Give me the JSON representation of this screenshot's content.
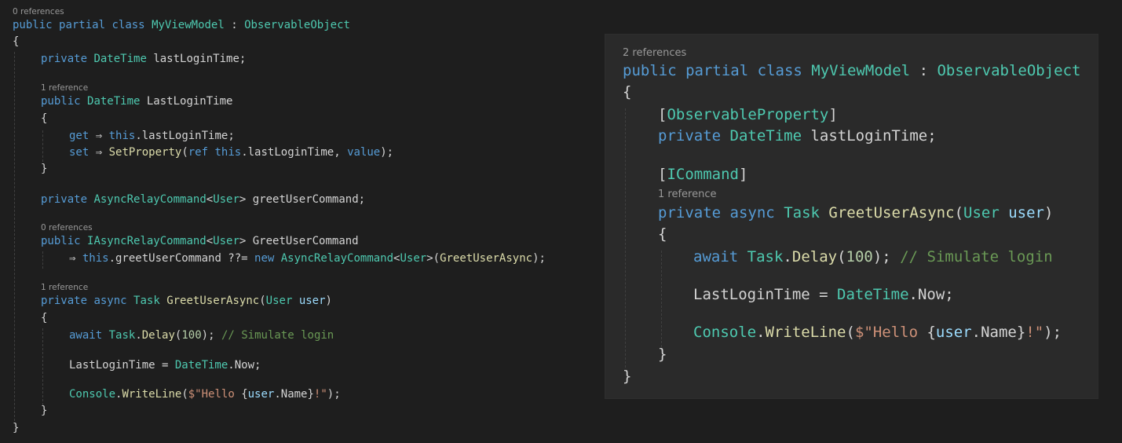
{
  "left": {
    "lens_0": "0 references",
    "lens_1": "1 reference",
    "lens_2": "0 references",
    "lens_3": "1 reference",
    "lines": [
      [
        [
          "kw",
          "public"
        ],
        [
          "pl",
          " "
        ],
        [
          "kw",
          "partial"
        ],
        [
          "pl",
          " "
        ],
        [
          "kw",
          "class"
        ],
        [
          "pl",
          " "
        ],
        [
          "ty",
          "MyViewModel"
        ],
        [
          "pl",
          " : "
        ],
        [
          "ty",
          "ObservableObject"
        ]
      ],
      [
        [
          "pl",
          "{"
        ]
      ],
      [
        [
          "kw",
          "private"
        ],
        [
          "pl",
          " "
        ],
        [
          "ty",
          "DateTime"
        ],
        [
          "pl",
          " lastLoginTime;"
        ]
      ],
      [
        [
          "kw",
          "public"
        ],
        [
          "pl",
          " "
        ],
        [
          "ty",
          "DateTime"
        ],
        [
          "pl",
          " LastLoginTime"
        ]
      ],
      [
        [
          "pl",
          "{"
        ]
      ],
      [
        [
          "kw",
          "get"
        ],
        [
          "pl",
          " ⇒ "
        ],
        [
          "kw",
          "this"
        ],
        [
          "pl",
          ".lastLoginTime;"
        ]
      ],
      [
        [
          "kw",
          "set"
        ],
        [
          "pl",
          " ⇒ "
        ],
        [
          "fn",
          "SetProperty"
        ],
        [
          "pl",
          "("
        ],
        [
          "kw",
          "ref"
        ],
        [
          "pl",
          " "
        ],
        [
          "kw",
          "this"
        ],
        [
          "pl",
          ".lastLoginTime, "
        ],
        [
          "kw",
          "value"
        ],
        [
          "pl",
          ");"
        ]
      ],
      [
        [
          "pl",
          "}"
        ]
      ],
      [
        [
          "kw",
          "private"
        ],
        [
          "pl",
          " "
        ],
        [
          "ty",
          "AsyncRelayCommand"
        ],
        [
          "pl",
          "<"
        ],
        [
          "ty",
          "User"
        ],
        [
          "pl",
          "> greetUserCommand;"
        ]
      ],
      [
        [
          "kw",
          "public"
        ],
        [
          "pl",
          " "
        ],
        [
          "ty",
          "IAsyncRelayCommand"
        ],
        [
          "pl",
          "<"
        ],
        [
          "ty",
          "User"
        ],
        [
          "pl",
          "> GreetUserCommand"
        ]
      ],
      [
        [
          "pl",
          "⇒ "
        ],
        [
          "kw",
          "this"
        ],
        [
          "pl",
          ".greetUserCommand ??= "
        ],
        [
          "kw",
          "new"
        ],
        [
          "pl",
          " "
        ],
        [
          "ty",
          "AsyncRelayCommand"
        ],
        [
          "pl",
          "<"
        ],
        [
          "ty",
          "User"
        ],
        [
          "pl",
          ">("
        ],
        [
          "fn",
          "GreetUserAsync"
        ],
        [
          "pl",
          ");"
        ]
      ],
      [
        [
          "kw",
          "private"
        ],
        [
          "pl",
          " "
        ],
        [
          "kw",
          "async"
        ],
        [
          "pl",
          " "
        ],
        [
          "ty",
          "Task"
        ],
        [
          "pl",
          " "
        ],
        [
          "fn",
          "GreetUserAsync"
        ],
        [
          "pl",
          "("
        ],
        [
          "ty",
          "User"
        ],
        [
          "pl",
          " "
        ],
        [
          "var",
          "user"
        ],
        [
          "pl",
          ")"
        ]
      ],
      [
        [
          "pl",
          "{"
        ]
      ],
      [
        [
          "kw",
          "await"
        ],
        [
          "pl",
          " "
        ],
        [
          "ty",
          "Task"
        ],
        [
          "pl",
          "."
        ],
        [
          "fn",
          "Delay"
        ],
        [
          "pl",
          "("
        ],
        [
          "num",
          "100"
        ],
        [
          "pl",
          "); "
        ],
        [
          "cmt",
          "// Simulate login"
        ]
      ],
      [
        [
          "pl",
          "LastLoginTime = "
        ],
        [
          "ty",
          "DateTime"
        ],
        [
          "pl",
          ".Now;"
        ]
      ],
      [
        [
          "ty",
          "Console"
        ],
        [
          "pl",
          "."
        ],
        [
          "fn",
          "WriteLine"
        ],
        [
          "pl",
          "("
        ],
        [
          "str",
          "$\"Hello "
        ],
        [
          "pl",
          "{"
        ],
        [
          "var",
          "user"
        ],
        [
          "pl",
          ".Name}"
        ],
        [
          "str",
          "!\""
        ],
        [
          "pl",
          ");"
        ]
      ],
      [
        [
          "pl",
          "}"
        ]
      ],
      [
        [
          "pl",
          "}"
        ]
      ]
    ]
  },
  "right": {
    "lens_0": "2 references",
    "lens_1": "1 reference",
    "lines": [
      [
        [
          "kw",
          "public"
        ],
        [
          "pl",
          " "
        ],
        [
          "kw",
          "partial"
        ],
        [
          "pl",
          " "
        ],
        [
          "kw",
          "class"
        ],
        [
          "pl",
          " "
        ],
        [
          "ty",
          "MyViewModel"
        ],
        [
          "pl",
          " : "
        ],
        [
          "ty",
          "ObservableObject"
        ]
      ],
      [
        [
          "pl",
          "{"
        ]
      ],
      [
        [
          "pl",
          "["
        ],
        [
          "ty",
          "ObservableProperty"
        ],
        [
          "pl",
          "]"
        ]
      ],
      [
        [
          "kw",
          "private"
        ],
        [
          "pl",
          " "
        ],
        [
          "ty",
          "DateTime"
        ],
        [
          "pl",
          " lastLoginTime;"
        ]
      ],
      [
        [
          "pl",
          "["
        ],
        [
          "ty",
          "ICommand"
        ],
        [
          "pl",
          "]"
        ]
      ],
      [
        [
          "kw",
          "private"
        ],
        [
          "pl",
          " "
        ],
        [
          "kw",
          "async"
        ],
        [
          "pl",
          " "
        ],
        [
          "ty",
          "Task"
        ],
        [
          "pl",
          " "
        ],
        [
          "fn",
          "GreetUserAsync"
        ],
        [
          "pl",
          "("
        ],
        [
          "ty",
          "User"
        ],
        [
          "pl",
          " "
        ],
        [
          "var",
          "user"
        ],
        [
          "pl",
          ")"
        ]
      ],
      [
        [
          "pl",
          "{"
        ]
      ],
      [
        [
          "kw",
          "await"
        ],
        [
          "pl",
          " "
        ],
        [
          "ty",
          "Task"
        ],
        [
          "pl",
          "."
        ],
        [
          "fn",
          "Delay"
        ],
        [
          "pl",
          "("
        ],
        [
          "num",
          "100"
        ],
        [
          "pl",
          "); "
        ],
        [
          "cmt",
          "// Simulate login"
        ]
      ],
      [
        [
          "pl",
          "LastLoginTime = "
        ],
        [
          "ty",
          "DateTime"
        ],
        [
          "pl",
          ".Now;"
        ]
      ],
      [
        [
          "ty",
          "Console"
        ],
        [
          "pl",
          "."
        ],
        [
          "fn",
          "WriteLine"
        ],
        [
          "pl",
          "("
        ],
        [
          "str",
          "$\"Hello "
        ],
        [
          "pl",
          "{"
        ],
        [
          "var",
          "user"
        ],
        [
          "pl",
          ".Name}"
        ],
        [
          "str",
          "!\""
        ],
        [
          "pl",
          ");"
        ]
      ],
      [
        [
          "pl",
          "}"
        ]
      ],
      [
        [
          "pl",
          "}"
        ]
      ]
    ]
  },
  "syntax_colors": {
    "kw": "#569cd6",
    "ty": "#4ec9b0",
    "fn": "#dcdcaa",
    "var": "#9cdcfe",
    "num": "#b5cea8",
    "str": "#ce9178",
    "cmt": "#6a9955",
    "pl": "#d4d4d4"
  }
}
